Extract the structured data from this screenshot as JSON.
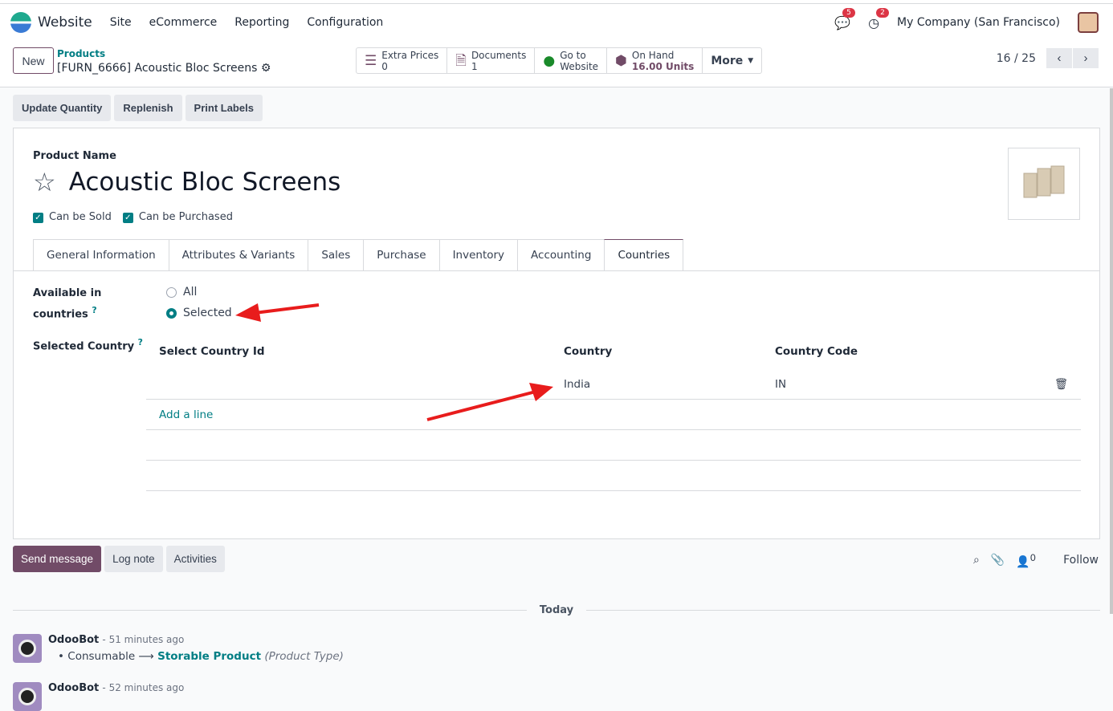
{
  "nav": {
    "app": "Website",
    "menus": [
      "Site",
      "eCommerce",
      "Reporting",
      "Configuration"
    ],
    "messages_count": "5",
    "activities_count": "2",
    "company": "My Company (San Francisco)"
  },
  "control": {
    "new_label": "New",
    "breadcrumb_parent": "Products",
    "breadcrumb_current": "[FURN_6666] Acoustic Bloc Screens",
    "stats": [
      {
        "label": "Extra Prices",
        "value": "0"
      },
      {
        "label": "Documents",
        "value": "1"
      },
      {
        "label": "Go to",
        "value": "Website"
      },
      {
        "label": "On Hand",
        "value": "16.00 Units"
      }
    ],
    "more_label": "More",
    "pager": "16 / 25"
  },
  "actions": [
    "Update Quantity",
    "Replenish",
    "Print Labels"
  ],
  "form": {
    "product_name_label": "Product Name",
    "product_name": "Acoustic Bloc Screens",
    "can_be_sold": "Can be Sold",
    "can_be_purchased": "Can be Purchased",
    "tabs": [
      "General Information",
      "Attributes & Variants",
      "Sales",
      "Purchase",
      "Inventory",
      "Accounting",
      "Countries"
    ],
    "available_label_1": "Available in",
    "available_label_2": "countries",
    "help_mark": "?",
    "radio_all": "All",
    "radio_selected": "Selected",
    "selected_country_label": "Selected Country",
    "columns": [
      "Select Country Id",
      "Country",
      "Country Code"
    ],
    "rows": [
      {
        "select_country_id": "",
        "country": "India",
        "code": "IN"
      }
    ],
    "add_line": "Add a line"
  },
  "chatter": {
    "send_message": "Send message",
    "log_note": "Log note",
    "activities": "Activities",
    "followers_count": "0",
    "follow": "Follow",
    "today": "Today",
    "messages": [
      {
        "author": "OdooBot",
        "time": "- 51 minutes ago",
        "old": "Consumable",
        "new": "Storable Product",
        "field": "(Product Type)"
      },
      {
        "author": "OdooBot",
        "time": "- 52 minutes ago"
      }
    ]
  },
  "colors": {
    "brand": "#714b67",
    "accent": "#017e84",
    "annotation": "#e81c1c"
  }
}
